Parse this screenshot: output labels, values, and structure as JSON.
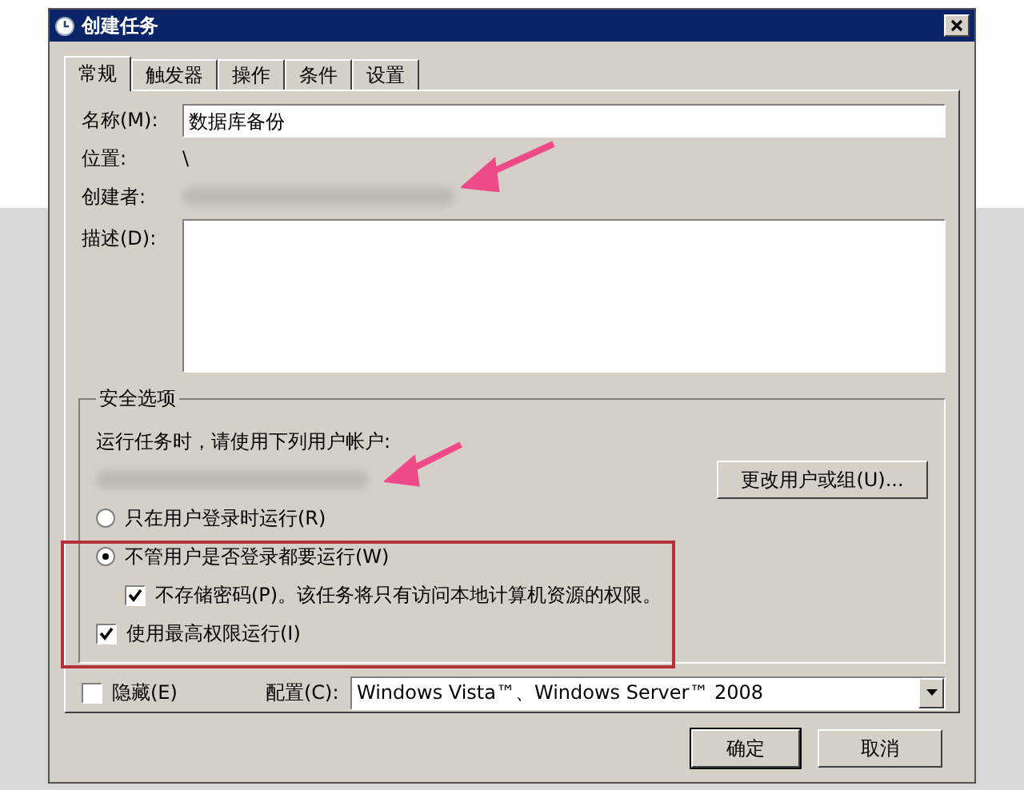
{
  "window": {
    "title": "创建任务"
  },
  "tabs": [
    {
      "label": "常规",
      "selected": true
    },
    {
      "label": "触发器",
      "selected": false
    },
    {
      "label": "操作",
      "selected": false
    },
    {
      "label": "条件",
      "selected": false
    },
    {
      "label": "设置",
      "selected": false
    }
  ],
  "general": {
    "name_label": "名称(M):",
    "name_value": "数据库备份",
    "location_label": "位置:",
    "location_value": "\\",
    "author_label": "创建者:",
    "description_label": "描述(D):"
  },
  "security": {
    "title": "安全选项",
    "account_label": "运行任务时，请使用下列用户帐户:",
    "change_button": "更改用户或组(U)...",
    "options": [
      {
        "kind": "radio",
        "label": "只在用户登录时运行(R)",
        "selected": false
      },
      {
        "kind": "radio",
        "label": "不管用户是否登录都要运行(W)",
        "selected": true,
        "children": [
          {
            "kind": "checkbox",
            "label": "不存储密码(P)。该任务将只有访问本地计算机资源的权限。",
            "checked": true
          }
        ]
      },
      {
        "kind": "checkbox",
        "label": "使用最高权限运行(I)",
        "checked": true
      }
    ]
  },
  "hidden": {
    "label": "隐藏(E)",
    "checked": false
  },
  "config": {
    "label": "配置(C):",
    "value": "Windows Vista™、Windows Server™ 2008"
  },
  "buttons": [
    "确定",
    "取消"
  ]
}
